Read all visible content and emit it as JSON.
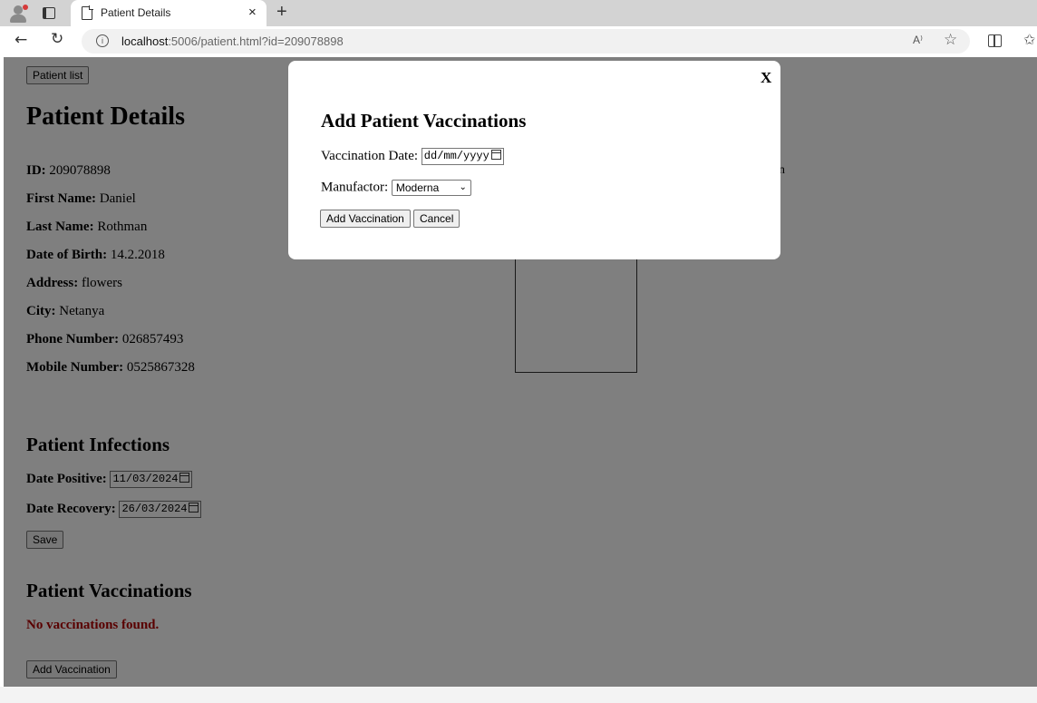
{
  "browser": {
    "tab_title": "Patient Details",
    "tab_close": "×",
    "new_tab": "+",
    "url_host": "localhost",
    "url_rest": ":5006/patient.html?id=209078898",
    "read_aloud": "A⁾"
  },
  "page": {
    "patient_list_button": "Patient list",
    "title": "Patient Details",
    "fields": [
      {
        "label": "ID:",
        "value": "209078898"
      },
      {
        "label": "First Name:",
        "value": "Daniel"
      },
      {
        "label": "Last Name:",
        "value": "Rothman"
      },
      {
        "label": "Date of Birth:",
        "value": "14.2.2018"
      },
      {
        "label": "Address:",
        "value": "flowers"
      },
      {
        "label": "City:",
        "value": "Netanya"
      },
      {
        "label": "Phone Number:",
        "value": "026857493"
      },
      {
        "label": "Mobile Number:",
        "value": "0525867328"
      }
    ],
    "partial_text": "n",
    "infections": {
      "heading": "Patient Infections",
      "date_positive_label": "Date Positive:",
      "date_positive_value": "11/03/2024",
      "date_recovery_label": "Date Recovery:",
      "date_recovery_value": "26/03/2024",
      "save_button": "Save"
    },
    "vaccinations": {
      "heading": "Patient Vaccinations",
      "empty_message": "No vaccinations found.",
      "add_button": "Add Vaccination"
    }
  },
  "modal": {
    "close": "X",
    "title": "Add Patient Vaccinations",
    "date_label": "Vaccination Date:",
    "date_placeholder": "dd/mm/yyyy",
    "manufacturer_label": "Manufactor:",
    "manufacturer_value": "Moderna",
    "add_button": "Add Vaccination",
    "cancel_button": "Cancel"
  },
  "colors": {
    "overlay": "#808080",
    "error_text": "#b30000",
    "modal_bg": "#ffffff"
  }
}
